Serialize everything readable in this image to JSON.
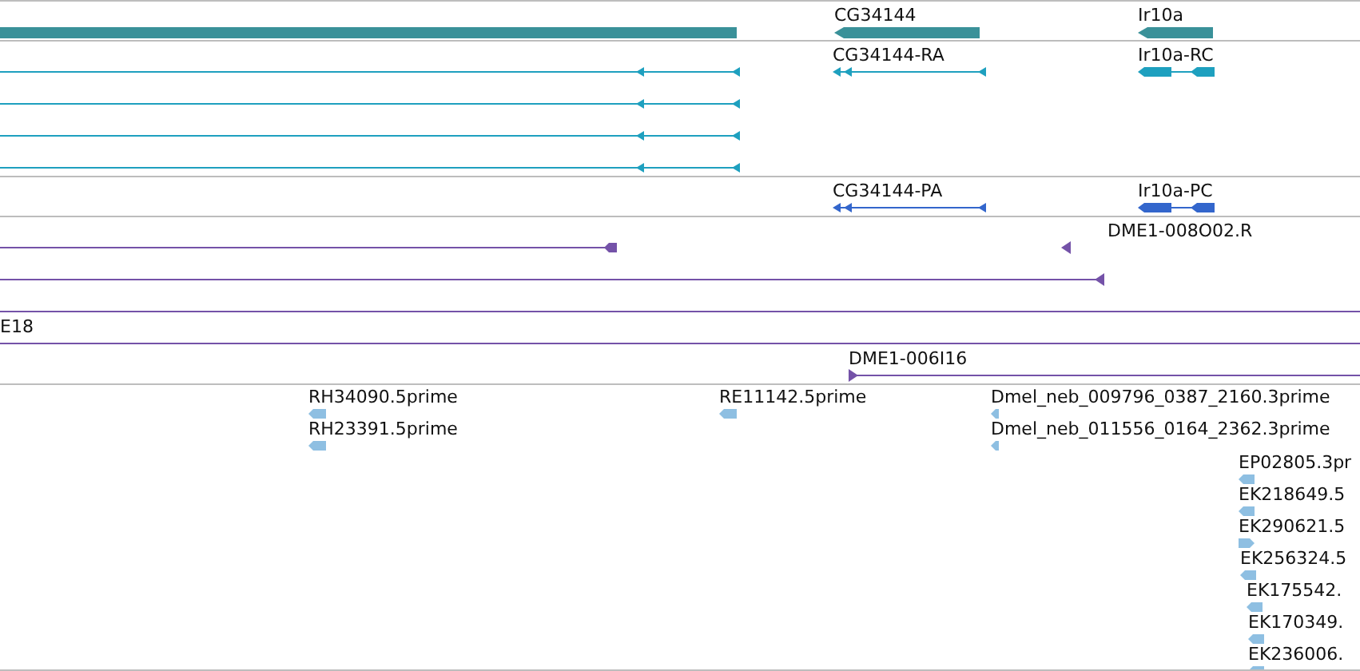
{
  "tracks": [
    {
      "kind": "genes",
      "color": "#3a9199",
      "features": [
        {
          "kind": "bar"
        },
        {
          "kind": "arrowbar",
          "label": "CG34144"
        },
        {
          "kind": "arrowbar",
          "label": "Ir10a"
        }
      ]
    },
    {
      "kind": "transcripts",
      "color": "#1ea0bf",
      "features": [
        {
          "kind": "long"
        },
        {
          "kind": "long"
        },
        {
          "kind": "long"
        },
        {
          "kind": "long"
        },
        {
          "kind": "ra",
          "label": "CG34144-RA"
        },
        {
          "kind": "rc",
          "label": "Ir10a-RC"
        }
      ]
    },
    {
      "kind": "proteins",
      "color": "#3366cc",
      "features": [
        {
          "kind": "ra",
          "label": "CG34144-PA"
        },
        {
          "kind": "rc",
          "label": "Ir10a-PC"
        }
      ]
    },
    {
      "kind": "alignments",
      "color": "#7452a8",
      "features": [
        {
          "kind": "pend"
        },
        {
          "kind": "parrow",
          "label": "DME1-008O02.R"
        },
        {
          "kind": "pend2"
        },
        {
          "kind": "full"
        },
        {
          "kind": "full",
          "label": "E18"
        },
        {
          "kind": "pstart",
          "label": "DME1-006I16"
        }
      ]
    },
    {
      "kind": "ests",
      "color": "#8ebfe2",
      "features": [
        {
          "kind": "est",
          "label": "RH34090.5prime"
        },
        {
          "kind": "est",
          "label": "RE11142.5prime"
        },
        {
          "kind": "est",
          "label": "Dmel_neb_009796_0387_2160.3prime"
        },
        {
          "kind": "est",
          "label": "RH23391.5prime"
        },
        {
          "kind": "est",
          "label": "Dmel_neb_011556_0164_2362.3prime"
        },
        {
          "kind": "est",
          "label": "EP02805.3pr"
        },
        {
          "kind": "est",
          "label": "EK218649.5"
        },
        {
          "kind": "estr",
          "label": "EK290621.5"
        },
        {
          "kind": "est",
          "label": "EK256324.5"
        },
        {
          "kind": "est",
          "label": "EK175542."
        },
        {
          "kind": "est",
          "label": "EK170349."
        },
        {
          "kind": "est",
          "label": "EK236006."
        }
      ]
    }
  ]
}
